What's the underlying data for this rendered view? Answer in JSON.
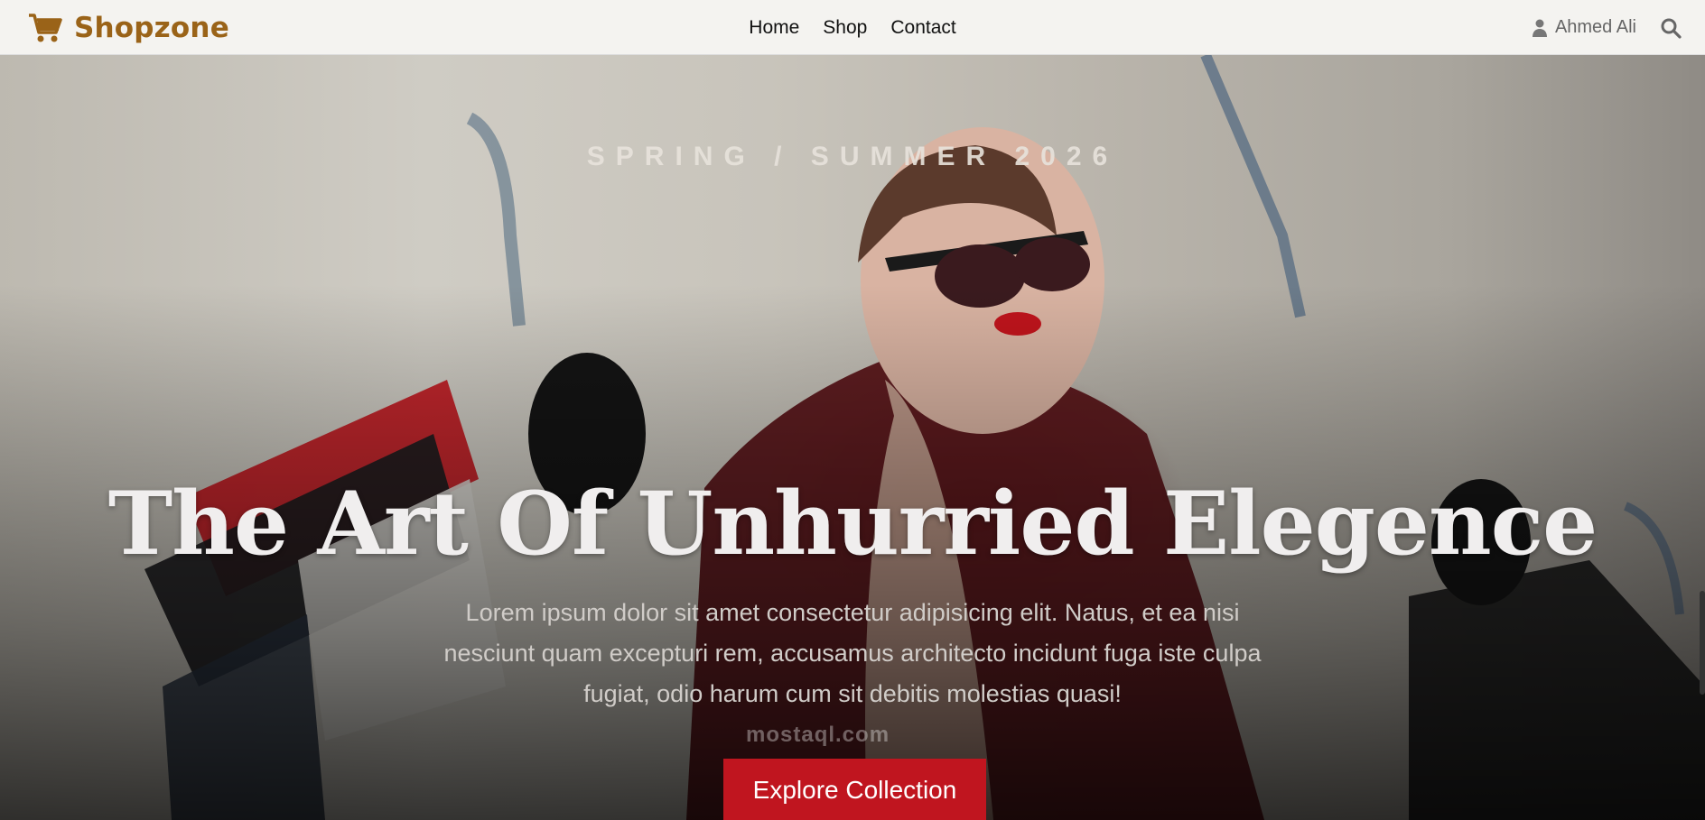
{
  "header": {
    "brand": "Shopzone",
    "nav": [
      "Home",
      "Shop",
      "Contact"
    ],
    "user_name": "Ahmed Ali"
  },
  "hero": {
    "kicker": "SPRING / SUMMER 2026",
    "title": "The Art Of Unhurried Elegence",
    "description": "Lorem ipsum dolor sit amet consectetur adipisicing elit. Natus, et ea nisi nesciunt quam excepturi rem, accusamus architecto incidunt fuga iste culpa fugiat, odio harum cum sit debitis molestias quasi!",
    "cta": "Explore Collection",
    "watermark": "mostaql.com"
  },
  "colors": {
    "brand": "#9a6318",
    "accent": "#c0151f",
    "nav_bg": "#f4f3f0"
  },
  "icons": {
    "cart": "shopping-cart-icon",
    "user": "user-icon",
    "search": "search-icon"
  }
}
